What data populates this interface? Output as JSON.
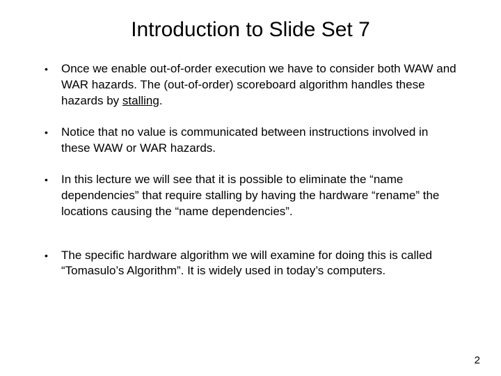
{
  "title": "Introduction to Slide Set 7",
  "bullets": [
    {
      "pre": "Once we enable out-of-order execution we have to consider both WAW and WAR hazards.   The (out-of-order) scoreboard algorithm handles these hazards by ",
      "underlined": "stalling",
      "post": "."
    },
    {
      "pre": "Notice that no value is communicated between instructions involved in these WAW or WAR hazards.",
      "underlined": "",
      "post": ""
    },
    {
      "pre": "In this lecture we will see that it is possible to eliminate the “name dependencies” that require stalling by having the hardware “rename” the locations causing the “name dependencies”.",
      "underlined": "",
      "post": ""
    },
    {
      "pre": "The specific hardware algorithm we will examine for doing this is called “Tomasulo’s Algorithm”.  It is widely used in today’s computers.",
      "underlined": "",
      "post": ""
    }
  ],
  "page_number": "2"
}
